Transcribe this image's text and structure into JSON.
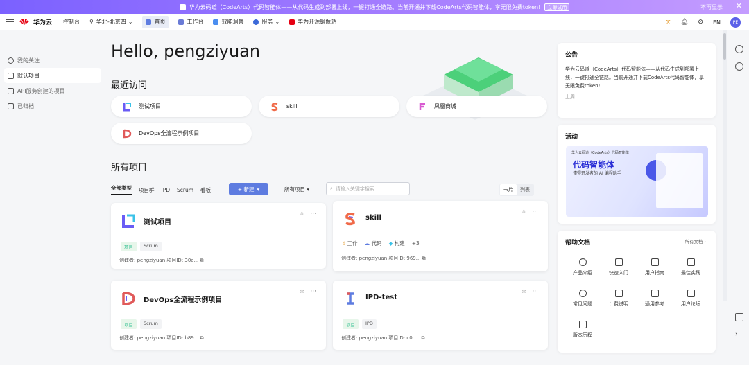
{
  "banner": {
    "text": "华为云码道（CodeArts）代码智能体——从代码生成到部署上线，一键打通全链路。当前开通并下载CodeArts代码智能体，享无限免费token!",
    "button": "立即试用",
    "dismiss": "不再显示",
    "close": "✕"
  },
  "topbar": {
    "brand": "华为云",
    "console": "控制台",
    "region": "华北-北京四",
    "nav": [
      {
        "label": "首页",
        "active": true
      },
      {
        "label": "工作台"
      },
      {
        "label": "效能洞察"
      },
      {
        "label": "服务"
      },
      {
        "label": "华为开源镜像站"
      }
    ],
    "lang": "EN",
    "avatar": "PE"
  },
  "sidebar": {
    "items": [
      {
        "label": "我的关注"
      },
      {
        "label": "默认项目",
        "active": true
      },
      {
        "label": "API服务创建的项目"
      },
      {
        "label": "已归档"
      }
    ]
  },
  "main": {
    "greeting": "Hello, pengziyuan",
    "recent_title": "最近访问",
    "recent": [
      "测试项目",
      "skill",
      "凤凰商城",
      "DevOps全流程示例项目"
    ],
    "all_title": "所有项目",
    "filter_tabs": [
      "全部类型",
      "项目群",
      "IPD",
      "Scrum",
      "看板"
    ],
    "new_button": "+ 新建",
    "project_filter": "所有项目",
    "search_placeholder": "请输入关键字搜索",
    "view_card": "卡片",
    "view_list": "列表",
    "cards": [
      {
        "name": "测试项目",
        "tags": [
          "项目",
          "Scrum"
        ],
        "meta": "创建者: pengziyuan  项目ID: 30a..."
      },
      {
        "name": "skill",
        "icons": [
          "工作",
          "代码",
          "构建",
          "+3"
        ],
        "meta": "创建者: pengziyuan  项目ID: 969..."
      },
      {
        "name": "DevOps全流程示例项目",
        "tags": [
          "项目",
          "Scrum"
        ],
        "meta": "创建者: pengziyuan  项目ID: b89..."
      },
      {
        "name": "IPD-test",
        "tags": [
          "项目",
          "IPD"
        ],
        "meta": "创建者: pengziyuan  项目ID: c0c..."
      }
    ]
  },
  "right": {
    "notice_title": "公告",
    "notice_text": "华为云码道（CodeArts）代码智能体——从代码生成到部署上线，一键打通全链路。当前开通并下载CodeArts代码智能体，享无限免费token!",
    "notice_more": "上周",
    "activity_title": "活动",
    "activity_banner_title": "代码智能体",
    "activity_banner_sub": "懂得开发者的 AI 编程助手",
    "activity_brand": "华为云码道（CodeArts）代码智能体",
    "docs_title": "帮助文档",
    "docs_all": "所有文档 ›",
    "docs": [
      "产品介绍",
      "快速入门",
      "用户指南",
      "最佳实践",
      "常见问题",
      "计费说明",
      "通用参考",
      "用户论坛",
      "版本历程"
    ]
  },
  "colors": {
    "accent": "#5e7ce0",
    "banner_start": "#7b61ff",
    "tag_green": "#3ac295"
  }
}
